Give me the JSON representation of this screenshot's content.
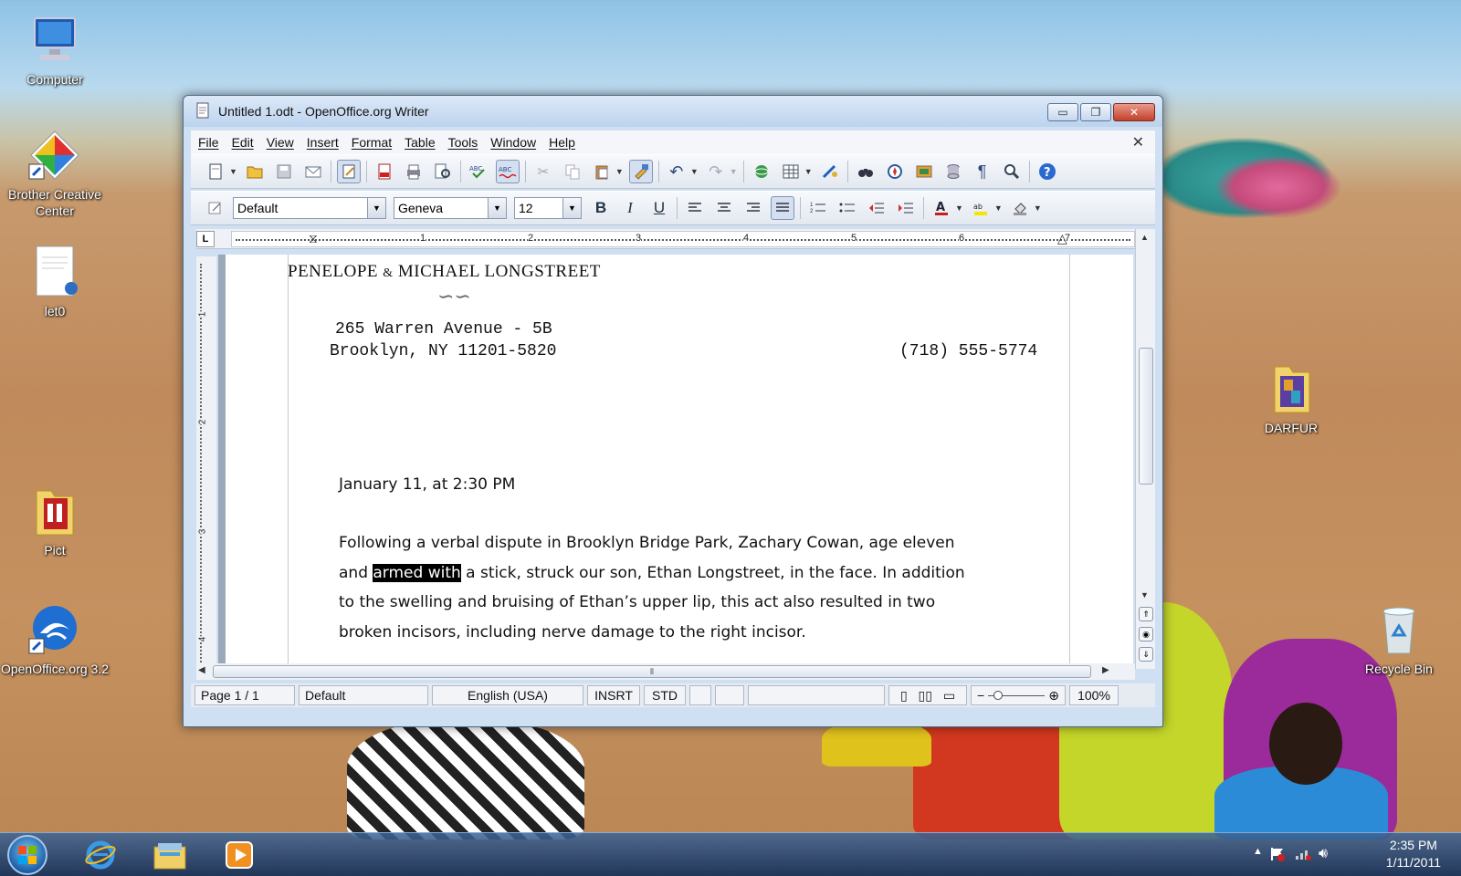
{
  "desktop": {
    "icons": [
      {
        "label": "Computer"
      },
      {
        "label": "Brother Creative Center"
      },
      {
        "label": "let0"
      },
      {
        "label": "Pict"
      },
      {
        "label": "OpenOffice.org 3.2"
      },
      {
        "label": "DARFUR"
      },
      {
        "label": "Recycle Bin"
      }
    ]
  },
  "window": {
    "title": "Untitled 1.odt - OpenOffice.org Writer",
    "minimize_glyph": "▭",
    "maximize_glyph": "❐",
    "close_glyph": "✕",
    "menu": [
      "File",
      "Edit",
      "View",
      "Insert",
      "Format",
      "Table",
      "Tools",
      "Window",
      "Help"
    ],
    "doc_close_glyph": "✕"
  },
  "formatting": {
    "style_value": "Default",
    "font_value": "Geneva",
    "size_value": "12",
    "bold_glyph": "B",
    "italic_glyph": "I",
    "underline_glyph": "U"
  },
  "ruler": {
    "corner": "L",
    "marks": [
      "1",
      "2",
      "3",
      "4",
      "5",
      "6",
      "7"
    ],
    "vertical_marks": [
      "1",
      "2",
      "3",
      "4"
    ]
  },
  "document": {
    "letterhead_first": "PENELOPE",
    "letterhead_amp": "&",
    "letterhead_second": "MICHAEL LONGSTREET",
    "ornament": "∽∽",
    "address_line1": "265 Warren Avenue - 5B",
    "address_line2": "Brooklyn, NY 11201-5820",
    "phone": "(718) 555-5774",
    "date_line": "January 11, at 2:30 PM",
    "para_line1": "Following a verbal dispute in Brooklyn Bridge Park, Zachary Cowan, age eleven",
    "para_line2_before": "and ",
    "para_line2_selected": "armed with",
    "para_line2_after": " a stick, struck our son, Ethan Longstreet, in the face. In addition",
    "para_line3": "to the swelling and bruising of Ethan’s upper lip, this act also resulted in two",
    "para_line4": "broken incisors, including nerve damage to the right incisor."
  },
  "statusbar": {
    "page": "Page 1 / 1",
    "page_style": "Default",
    "language": "English (USA)",
    "insert_mode": "INSRT",
    "selection_mode": "STD",
    "zoom": "100%"
  },
  "taskbar": {
    "clock_time": "2:35 PM",
    "clock_date": "1/11/2011"
  }
}
